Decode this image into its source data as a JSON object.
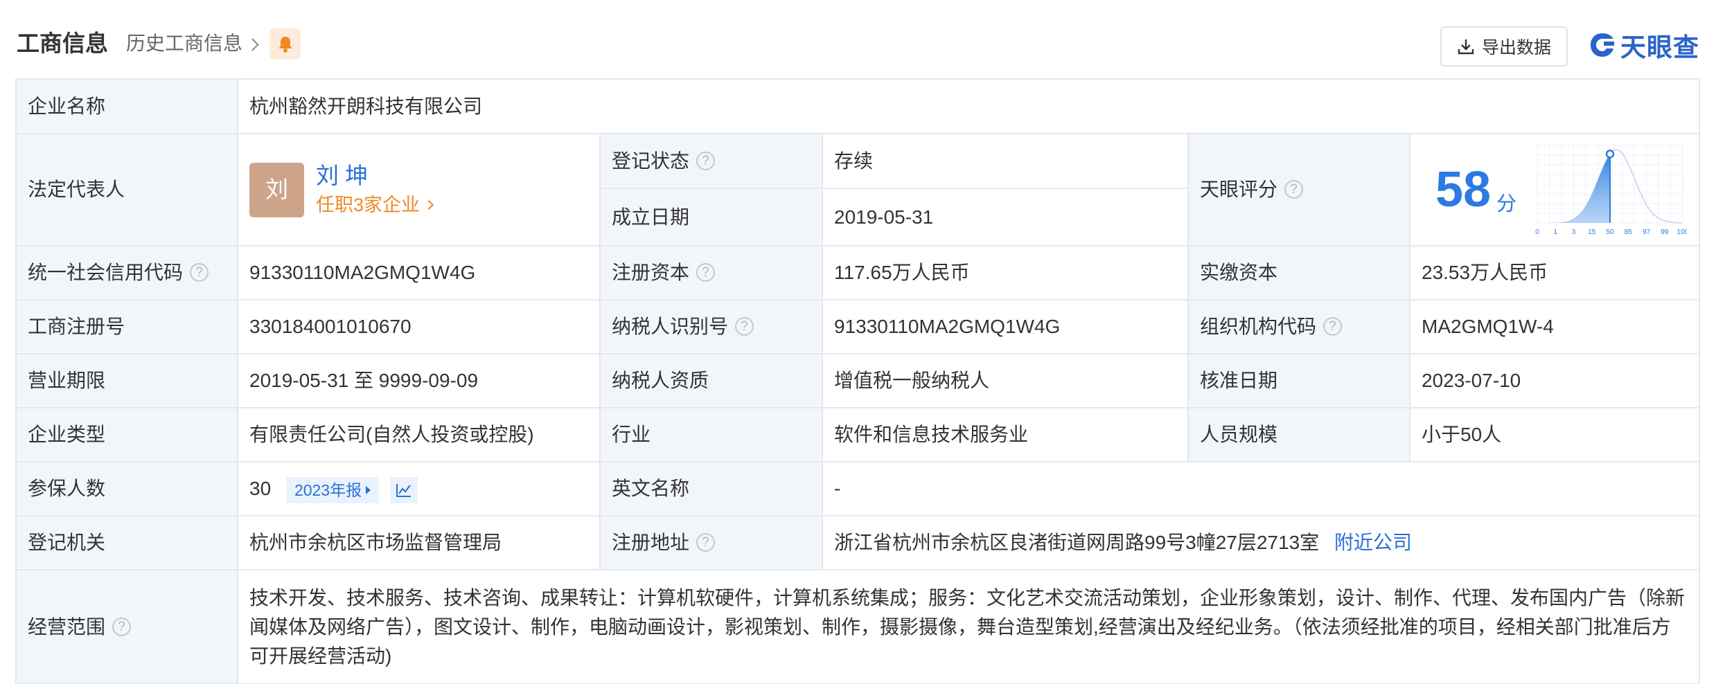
{
  "header": {
    "title": "工商信息",
    "history_label": "历史工商信息",
    "export_label": "导出数据",
    "logo_text": "天眼查"
  },
  "rows": {
    "company_name": {
      "label": "企业名称",
      "value": "杭州豁然开朗科技有限公司"
    },
    "legal_rep": {
      "label": "法定代表人",
      "avatar_char": "刘",
      "name": "刘  坤",
      "positions": "任职3家企业"
    },
    "reg_status": {
      "label": "登记状态",
      "value": "存续"
    },
    "found_date": {
      "label": "成立日期",
      "value": "2019-05-31"
    },
    "tianyan_score": {
      "label": "天眼评分",
      "score": "58",
      "unit": "分",
      "score_value": 58,
      "axis_ticks": [
        "0",
        "1",
        "3",
        "15",
        "50",
        "85",
        "97",
        "99",
        "100"
      ]
    },
    "credit_code": {
      "label": "统一社会信用代码",
      "value": "91330110MA2GMQ1W4G"
    },
    "reg_capital": {
      "label": "注册资本",
      "value": "117.65万人民币"
    },
    "paid_capital": {
      "label": "实缴资本",
      "value": "23.53万人民币"
    },
    "biz_reg_no": {
      "label": "工商注册号",
      "value": "330184001010670"
    },
    "taxpayer_id": {
      "label": "纳税人识别号",
      "value": "91330110MA2GMQ1W4G"
    },
    "org_code": {
      "label": "组织机构代码",
      "value": "MA2GMQ1W-4"
    },
    "biz_term": {
      "label": "营业期限",
      "value": "2019-05-31 至 9999-09-09"
    },
    "taxpayer_qual": {
      "label": "纳税人资质",
      "value": "增值税一般纳税人"
    },
    "approval_date": {
      "label": "核准日期",
      "value": "2023-07-10"
    },
    "company_type": {
      "label": "企业类型",
      "value": "有限责任公司(自然人投资或控股)"
    },
    "industry": {
      "label": "行业",
      "value": "软件和信息技术服务业"
    },
    "staff_size": {
      "label": "人员规模",
      "value": "小于50人"
    },
    "insured": {
      "label": "参保人数",
      "value": "30",
      "report_badge": "2023年报"
    },
    "english_name": {
      "label": "英文名称",
      "value": "-"
    },
    "reg_authority": {
      "label": "登记机关",
      "value": "杭州市余杭区市场监督管理局"
    },
    "reg_address": {
      "label": "注册地址",
      "value": "浙江省杭州市余杭区良渚街道网周路99号3幢27层2713室",
      "nearby_link": "附近公司"
    },
    "biz_scope": {
      "label": "经营范围",
      "value": "技术开发、技术服务、技术咨询、成果转让：计算机软硬件，计算机系统集成；服务：文化艺术交流活动策划，企业形象策划，设计、制作、代理、发布国内广告（除新闻媒体及网络广告），图文设计、制作，电脑动画设计，影视策划、制作，摄影摄像，舞台造型策划,经营演出及经纪业务。（依法须经批准的项目，经相关部门批准后方可开展经营活动)"
    }
  },
  "colors": {
    "label_bg": "#f2f6fb",
    "border": "#e4e7ed",
    "link_blue": "#2a6fd8",
    "status_green": "#3aa153",
    "orange": "#f08a24",
    "score_blue": "#2b7be0"
  }
}
